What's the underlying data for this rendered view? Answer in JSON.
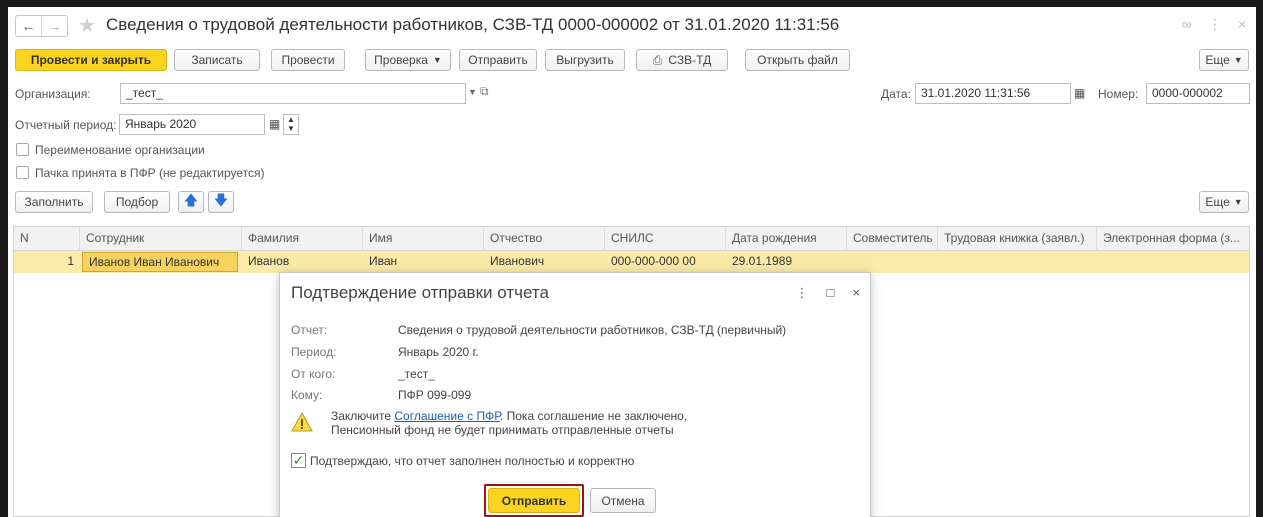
{
  "window": {
    "title": "Сведения о трудовой деятельности работников, СЗВ-ТД 0000-000002 от 31.01.2020 11:31:56"
  },
  "toolbar": {
    "post_close": "Провести и закрыть",
    "save": "Записать",
    "post": "Провести",
    "check": "Проверка",
    "send": "Отправить",
    "export": "Выгрузить",
    "print": "СЗВ-ТД",
    "open_file": "Открыть файл",
    "more": "Еще"
  },
  "form": {
    "org_label": "Организация:",
    "org_value": "_тест_",
    "date_label": "Дата:",
    "date_value": "31.01.2020 11:31:56",
    "number_label": "Номер:",
    "number_value": "0000-000002",
    "period_label": "Отчетный период:",
    "period_value": "Январь 2020",
    "rename_org": "Переименование организации",
    "pfr_accepted": "Пачка принята в ПФР (не редактируется)"
  },
  "table_toolbar": {
    "fill": "Заполнить",
    "select": "Подбор",
    "more": "Еще"
  },
  "table": {
    "columns": [
      "N",
      "Сотрудник",
      "Фамилия",
      "Имя",
      "Отчество",
      "СНИЛС",
      "Дата рождения",
      "Совместитель",
      "Трудовая книжка (заявл.)",
      "Электронная форма (з..."
    ],
    "rows": [
      [
        "1",
        "Иванов Иван Иванович",
        "Иванов",
        "Иван",
        "Иванович",
        "000-000-000 00",
        "29.01.1989",
        "",
        "",
        ""
      ]
    ]
  },
  "dialog": {
    "title": "Подтверждение отправки отчета",
    "report_label": "Отчет:",
    "report_value": "Сведения о трудовой деятельности работников, СЗВ-ТД (первичный)",
    "period_label": "Период:",
    "period_value": "Январь 2020 г.",
    "from_label": "От кого:",
    "from_value": "_тест_",
    "to_label": "Кому:",
    "to_value": "ПФР 099-099",
    "warn_prefix": "Заключите ",
    "warn_link": "Соглашение с ПФР",
    "warn_suffix": ". Пока соглашение не заключено,",
    "warn_line2": "Пенсионный фонд не будет принимать отправленные отчеты",
    "confirm": "Подтверждаю, что отчет заполнен полностью и корректно",
    "send": "Отправить",
    "cancel": "Отмена"
  },
  "colors": {
    "accent": "#fbd320",
    "row_highlight": "#fbeaa8",
    "link": "#1a5fb4",
    "focus_outline": "#a01010"
  }
}
